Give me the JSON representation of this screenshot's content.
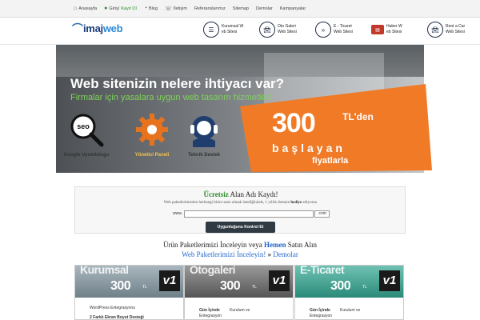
{
  "topnav": {
    "home": "Anasayfa",
    "login": "Giriş/",
    "signup": "Kayıt Ol",
    "blog": "Blog",
    "contact": "İletişim",
    "refs": "Referanslarımız",
    "sitemap": "Sitemap",
    "demos": "Demolar",
    "campaigns": "Kampanyalar"
  },
  "logo": {
    "brand": "imaj",
    "brand2": "web"
  },
  "menu": [
    {
      "label": "Kurumsal W\neb Sitesi",
      "icon": "list-icon"
    },
    {
      "label": "Oto Galeri\nWeb Sitesi",
      "icon": "car-icon"
    },
    {
      "label": "E - Ticaret\nWeb Sitesi",
      "icon": "cart-icon"
    },
    {
      "label": "Haber    W\neb Sitesi",
      "icon": "news-icon"
    },
    {
      "label": "Rent a Car\nWeb Sitesi",
      "icon": "car-icon"
    }
  ],
  "banner": {
    "headline": "Web sitenizin nelere ihtiyacı var?",
    "subline": "Firmalar için yasalara uygun web tasarım hizmetleri",
    "features": [
      {
        "caption": "Google Uyumlulugu",
        "icon": "seo-magnifier-icon",
        "color": "#111111"
      },
      {
        "caption": "Yönetici Paneli",
        "icon": "gear-icon",
        "color": "#e8731f"
      },
      {
        "caption": "Teknik Destek",
        "icon": "headset-icon",
        "color": "#1f3e6e"
      }
    ],
    "price": "300",
    "price_unit": "TL'den",
    "price_line2": "başlayan",
    "price_line3": "fiyatlarla",
    "price_color": "#f07a26"
  },
  "domain": {
    "title_green": "Ücretsiz",
    "title_rest": " Alan Adı Kaydı!",
    "sub_pre": "Web paketlerimizden herhangi birini satın almak istediğinizde, 1 yıllık domain ",
    "sub_bold": "hediye",
    "sub_post": " ediyoruz.",
    "www_label": "www.",
    "input_value": "",
    "tld": ".com",
    "button": "Uygunluğunu Kontrol Et"
  },
  "packages_heading": {
    "pre": "Ürün Paketlerimizi İnceleyin veya ",
    "bold": "Hemen",
    "post": " Satın Alın",
    "link": "Web Paketlerimizi İnceleyin!",
    "sep": " » ",
    "demos": "Demolar"
  },
  "cards": [
    {
      "name": "Kurumsal",
      "price": "300",
      "unit": "TL",
      "version": "v1",
      "color": "#8a9aa3",
      "line1": "WordPress Entegrasyonu",
      "line2": "2 Farklı Ekran Boyut Desteği",
      "line3": ""
    },
    {
      "name": "Otogaleri",
      "price": "300",
      "unit": "TL",
      "version": "v1",
      "color": "#7b7b7b",
      "line1": "Gün İçinde",
      "line2": "Entegrasyon",
      "line3": "Kurulum ve"
    },
    {
      "name": "E-Ticaret",
      "price": "300",
      "unit": "TL",
      "version": "v1",
      "color": "#3a9e8c",
      "line1": "Gün İçinde",
      "line2": "Entegrasyon",
      "line3": "Kurulum ve"
    }
  ]
}
